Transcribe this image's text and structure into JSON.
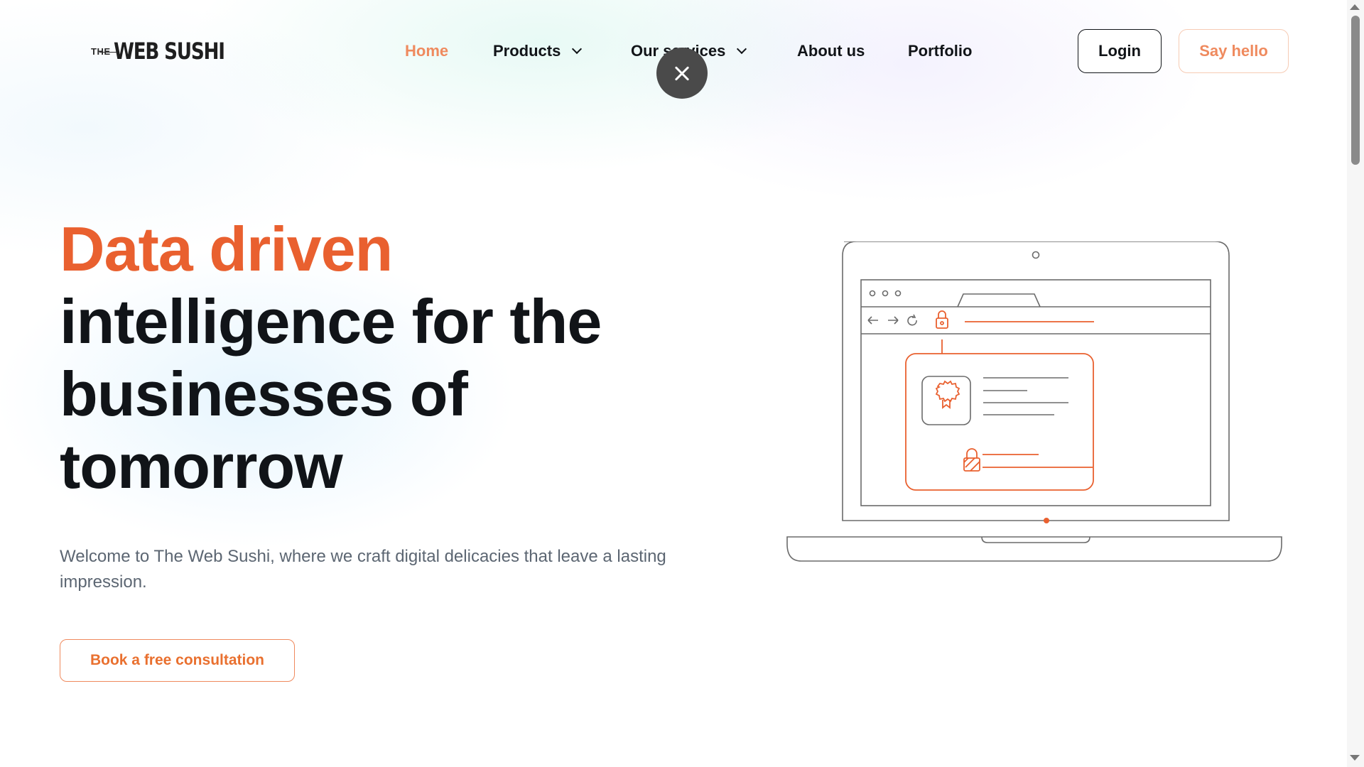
{
  "brand": {
    "prefix": "THE",
    "name": "WEB SUSHI"
  },
  "nav": {
    "items": [
      {
        "label": "Home",
        "active": true,
        "dropdown": false
      },
      {
        "label": "Products",
        "active": false,
        "dropdown": true
      },
      {
        "label": "Our services",
        "active": false,
        "dropdown": true
      },
      {
        "label": "About us",
        "active": false,
        "dropdown": false
      },
      {
        "label": "Portfolio",
        "active": false,
        "dropdown": false
      }
    ]
  },
  "header_actions": {
    "login_label": "Login",
    "hello_label": "Say hello"
  },
  "hero": {
    "title_accent": "Data driven",
    "title_rest": "intelligence for the businesses of tomorrow",
    "subtitle": "Welcome to The Web Sushi, where we craft digital delicacies that leave a lasting impression.",
    "cta_label": "Book a free consultation"
  },
  "illustration": {
    "name": "laptop-secure-browser-illustration"
  },
  "colors": {
    "accent": "#e9602f",
    "nav_active": "#ef8a5e",
    "text_dark": "#111418",
    "text_muted": "#5c6672",
    "illustration_line": "#6b6b6b",
    "illustration_accent": "#e9602f"
  },
  "icons": {
    "close": "close-icon",
    "chevron": "chevron-down-icon"
  }
}
